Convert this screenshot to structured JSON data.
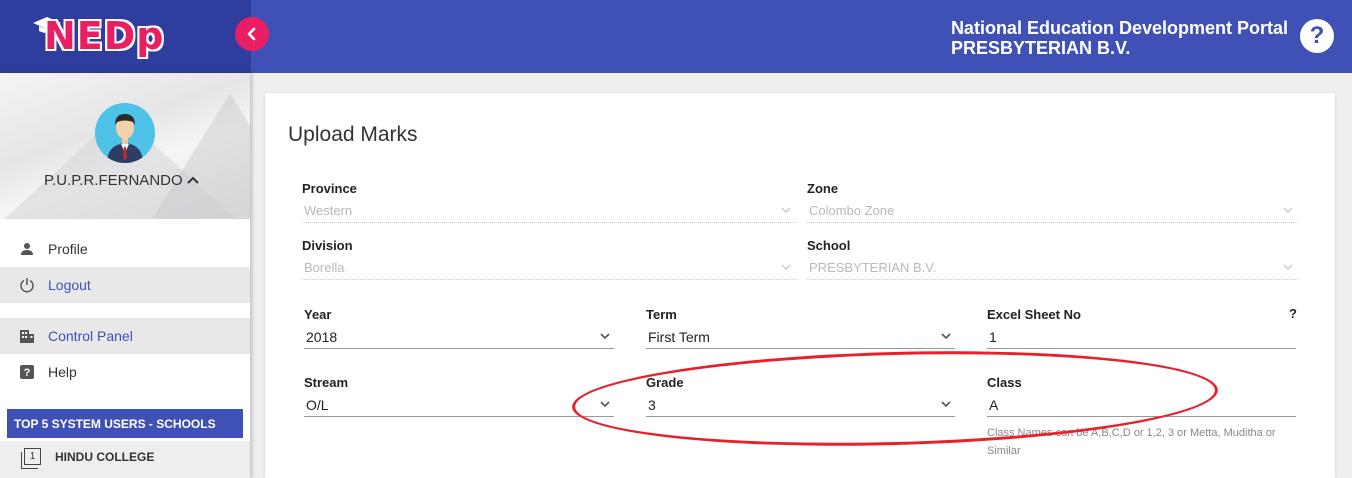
{
  "header": {
    "logo_text": "NEDp",
    "portal_title": "National Education Development Portal",
    "school_title": "PRESBYTERIAN B.V.",
    "help_symbol": "?",
    "primary_color": "#3f51b5",
    "accent_color": "#e91e63"
  },
  "sidebar": {
    "user_name": "P.U.P.R.FERNANDO",
    "menu": [
      {
        "label": "Profile",
        "icon": "person-icon"
      },
      {
        "label": "Logout",
        "icon": "power-icon"
      },
      {
        "label": "Control Panel",
        "icon": "building-icon"
      },
      {
        "label": "Help",
        "icon": "help-box-icon"
      }
    ],
    "top5_title": "TOP 5 SYSTEM USERS - SCHOOLS",
    "top_school": {
      "rank": "1",
      "name": "HINDU COLLEGE"
    }
  },
  "form": {
    "title": "Upload Marks",
    "province": {
      "label": "Province",
      "value": "Western"
    },
    "zone": {
      "label": "Zone",
      "value": "Colombo Zone"
    },
    "division": {
      "label": "Division",
      "value": "Borella"
    },
    "school": {
      "label": "School",
      "value": "PRESBYTERIAN B.V."
    },
    "year": {
      "label": "Year",
      "value": "2018"
    },
    "term": {
      "label": "Term",
      "value": "First Term"
    },
    "excel_sheet": {
      "label": "Excel Sheet No",
      "value": "1",
      "help": "?"
    },
    "stream": {
      "label": "Stream",
      "value": "O/L"
    },
    "grade": {
      "label": "Grade",
      "value": "3"
    },
    "class": {
      "label": "Class",
      "value": "A",
      "hint": "Class Names can be A,B,C,D or 1,2, 3 or Metta, Muditha or Similar"
    }
  }
}
